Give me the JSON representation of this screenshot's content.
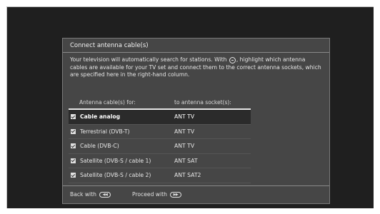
{
  "dialog": {
    "title": "Connect antenna cable(s)",
    "intro_part1": "Your television will automatically search for stations. With",
    "intro_part2": ", highlight which antenna cables are available for your TV set and connect them to the correct antenna sockets, which are specified here in the right-hand column.",
    "headers": {
      "col1": "Antenna cable(s) for:",
      "col2": "to antenna socket(s):"
    },
    "rows": [
      {
        "label": "Cable analog",
        "socket": "ANT TV",
        "checked": true,
        "selected": true
      },
      {
        "label": "Terrestrial (DVB-T)",
        "socket": "ANT TV",
        "checked": true,
        "selected": false
      },
      {
        "label": "Cable (DVB-C)",
        "socket": "ANT TV",
        "checked": true,
        "selected": false
      },
      {
        "label": "Satellite (DVB-S / cable 1)",
        "socket": "ANT SAT",
        "checked": true,
        "selected": false
      },
      {
        "label": "Satellite (DVB-S / cable 2)",
        "socket": "ANT SAT2",
        "checked": true,
        "selected": false
      }
    ],
    "footer": {
      "back_label": "Back with",
      "back_button_glyph": "◀◀",
      "proceed_label": "Proceed with",
      "proceed_button_glyph": "▶▶"
    }
  },
  "icons": {
    "inline_button": "ok-button-icon",
    "checkbox": "checkbox-checked-icon"
  }
}
